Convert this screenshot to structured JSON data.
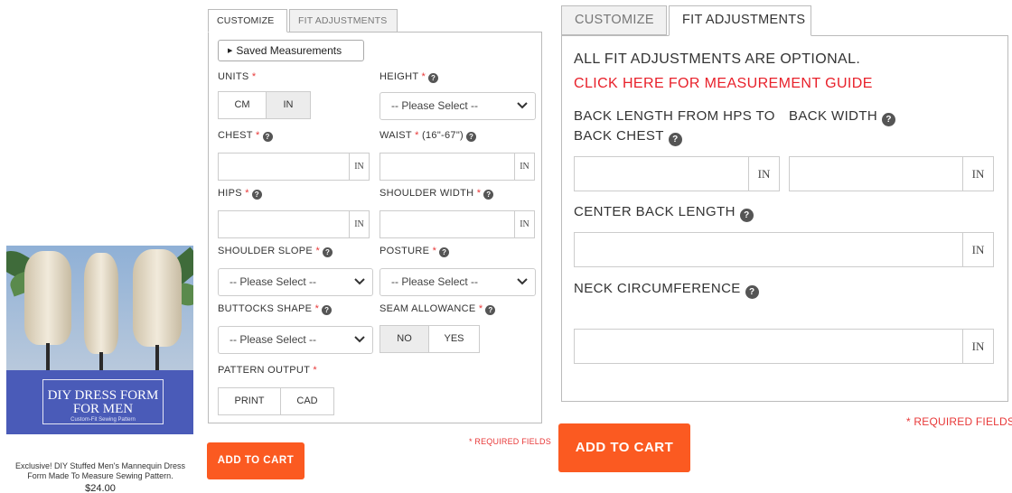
{
  "product": {
    "image_title": "DIY DRESS FORM FOR MEN",
    "image_subtitle": "Custom-Fit Sewing Pattern",
    "description": "Exclusive! DIY Stuffed Men's Mannequin Dress Form Made To Measure Sewing Pattern.",
    "price": "$24.00"
  },
  "small_form": {
    "tabs": [
      "CUSTOMIZE",
      "FIT ADJUSTMENTS"
    ],
    "saved_measurements": "Saved Measurements",
    "units_label": "UNITS",
    "units_options": [
      "CM",
      "IN"
    ],
    "height_label": "HEIGHT",
    "height_select": "-- Please Select --",
    "chest_label": "CHEST",
    "chest_unit": "IN",
    "waist_label": "WAIST",
    "waist_range": "(16\"-67\")",
    "waist_unit": "IN",
    "hips_label": "HIPS",
    "hips_unit": "IN",
    "shoulder_width_label": "SHOULDER WIDTH",
    "shoulder_width_unit": "IN",
    "shoulder_slope_label": "SHOULDER SLOPE",
    "shoulder_slope_select": "-- Please Select --",
    "posture_label": "POSTURE",
    "posture_select": "-- Please Select --",
    "buttocks_label": "BUTTOCKS SHAPE",
    "buttocks_select": "-- Please Select --",
    "seam_label": "SEAM ALLOWANCE",
    "seam_options": [
      "NO",
      "YES"
    ],
    "output_label": "PATTERN OUTPUT",
    "output_options": [
      "PRINT",
      "CAD"
    ],
    "required_asterisk": "*",
    "required_note": "* REQUIRED FIELDS",
    "add_to_cart": "ADD TO CART"
  },
  "large_form": {
    "tabs": [
      "CUSTOMIZE",
      "FIT ADJUSTMENTS"
    ],
    "optional_note": "ALL FIT ADJUSTMENTS ARE OPTIONAL.",
    "guide_link": "CLICK HERE FOR MEASUREMENT GUIDE",
    "back_length_label_line1": "BACK LENGTH FROM HPS TO",
    "back_length_label_line2": "BACK CHEST",
    "back_length_unit": "IN",
    "back_width_label": "BACK WIDTH",
    "back_width_unit": "IN",
    "center_back_label": "CENTER BACK LENGTH",
    "center_back_unit": "IN",
    "neck_label": "NECK CIRCUMFERENCE",
    "neck_unit": "IN",
    "required_note": "* REQUIRED FIELDS",
    "add_to_cart": "ADD TO CART"
  },
  "colors": {
    "accent": "#fb5a21",
    "required": "#e83838",
    "link": "#e8202a",
    "image_band": "#4a5bb8"
  }
}
